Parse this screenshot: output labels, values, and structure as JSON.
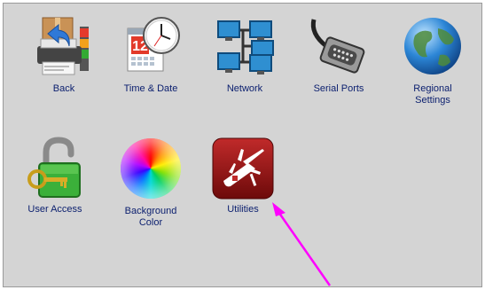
{
  "tiles": [
    {
      "id": "back",
      "label_lines": [
        "Back"
      ],
      "icon": "back-printer-icon"
    },
    {
      "id": "time-date",
      "label_lines": [
        "Time & Date"
      ],
      "icon": "calendar-clock-icon"
    },
    {
      "id": "network",
      "label_lines": [
        "Network"
      ],
      "icon": "network-icon"
    },
    {
      "id": "serial-ports",
      "label_lines": [
        "Serial Ports"
      ],
      "icon": "serial-port-icon"
    },
    {
      "id": "regional-settings",
      "label_lines": [
        "Regional",
        "Settings"
      ],
      "icon": "globe-icon"
    },
    {
      "id": "user-access",
      "label_lines": [
        "User Access"
      ],
      "icon": "padlock-key-icon"
    },
    {
      "id": "background-color",
      "label_lines": [
        "Background",
        "Color"
      ],
      "icon": "color-wheel-icon"
    },
    {
      "id": "utilities",
      "label_lines": [
        "Utilities"
      ],
      "icon": "swiss-knife-icon"
    }
  ],
  "calendar_day": "12",
  "colors": {
    "panel_bg": "#d4d4d4",
    "label_text": "#0a1e6e",
    "arrow": "#ff00ff",
    "utilities_bg": "#8b1010"
  },
  "annotation": {
    "type": "pointer-arrow",
    "target": "utilities"
  }
}
